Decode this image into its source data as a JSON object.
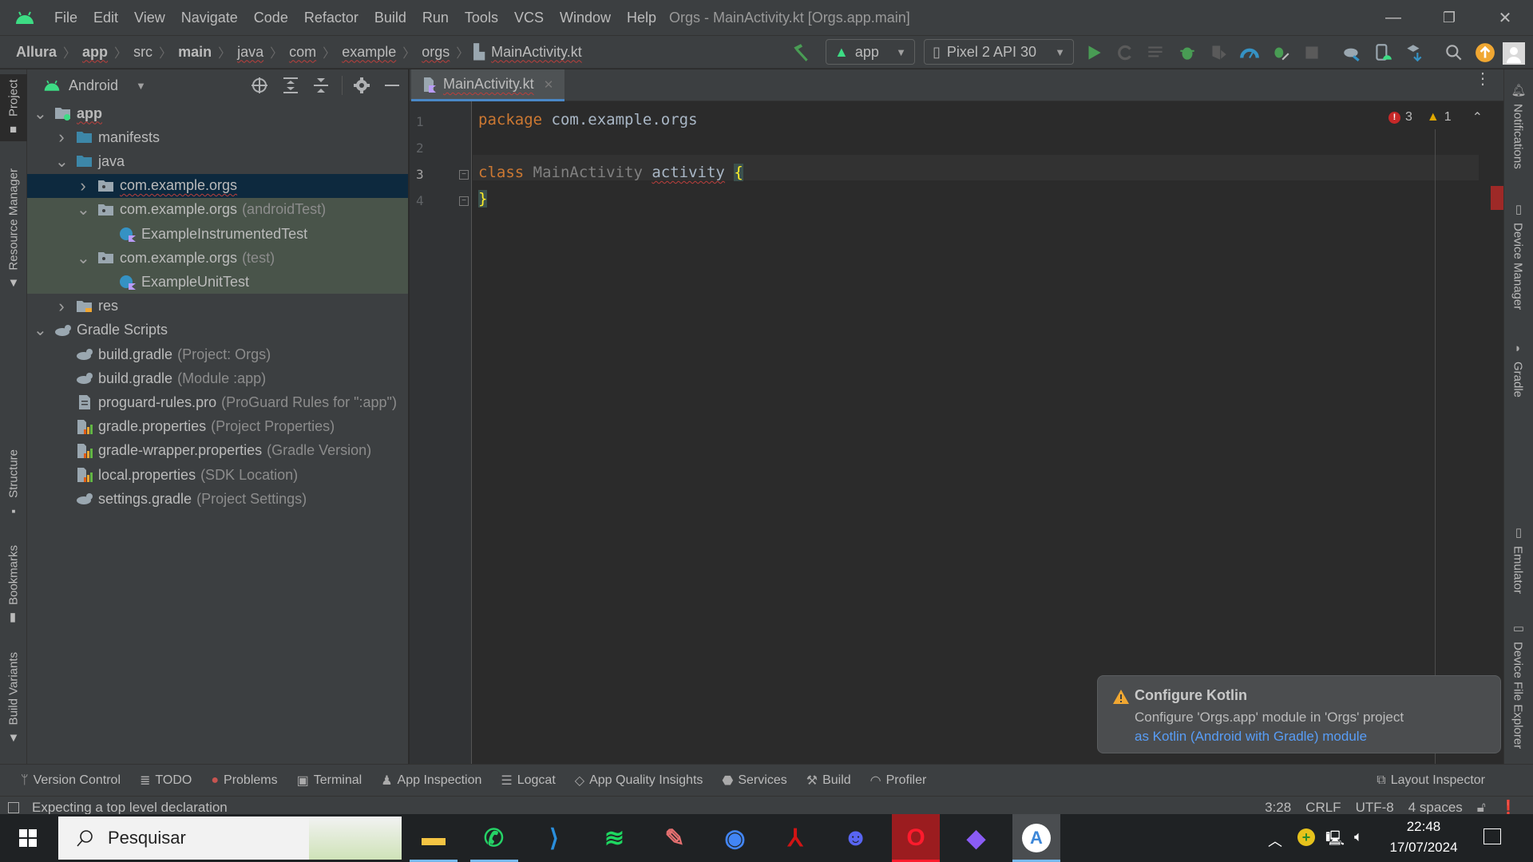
{
  "window": {
    "title": "Orgs - MainActivity.kt [Orgs.app.main]",
    "menu": [
      "File",
      "Edit",
      "View",
      "Navigate",
      "Code",
      "Refactor",
      "Build",
      "Run",
      "Tools",
      "VCS",
      "Window",
      "Help"
    ],
    "minimize": "—",
    "restore": "❐",
    "close": "✕"
  },
  "breadcrumb": [
    {
      "label": "Allura",
      "bold": true
    },
    {
      "label": "app",
      "bold": true
    },
    {
      "label": "src"
    },
    {
      "label": "main",
      "bold": true
    },
    {
      "label": "java"
    },
    {
      "label": "com"
    },
    {
      "label": "example"
    },
    {
      "label": "orgs"
    },
    {
      "label": "MainActivity.kt"
    }
  ],
  "toolbar": {
    "run_config": "app",
    "device": "Pixel 2 API 30",
    "icons": [
      "hammer-icon",
      "run-icon",
      "apply-changes-icon",
      "apply-code-changes-icon",
      "debug-icon",
      "coverage-icon",
      "profile-icon",
      "attach-debugger-icon",
      "stop-icon",
      "gradle-sync-icon",
      "device-manager-icon",
      "sdk-manager-icon",
      "search-icon",
      "update-icon",
      "avatar"
    ]
  },
  "left_strip": {
    "project": "Project",
    "resource_manager": "Resource Manager",
    "structure": "Structure",
    "bookmarks": "Bookmarks",
    "build_variants": "Build Variants"
  },
  "right_strip": {
    "notifications": "Notifications",
    "device_manager": "Device Manager",
    "gradle": "Gradle",
    "emulator": "Emulator",
    "device_file_explorer": "Device File Explorer"
  },
  "project": {
    "view_mode": "Android",
    "tree": [
      {
        "label": "app",
        "hint": "",
        "icon": "module",
        "chevron": "down",
        "indent": 0
      },
      {
        "label": "manifests",
        "hint": "",
        "icon": "folder",
        "chevron": "right",
        "indent": 1
      },
      {
        "label": "java",
        "hint": "",
        "icon": "folder",
        "chevron": "down",
        "indent": 1
      },
      {
        "label": "com.example.orgs",
        "hint": "",
        "icon": "package",
        "chevron": "right",
        "indent": 2,
        "state": "selected"
      },
      {
        "label": "com.example.orgs",
        "hint": "(androidTest)",
        "icon": "package",
        "chevron": "down",
        "indent": 2,
        "state": "test"
      },
      {
        "label": "ExampleInstrumentedTest",
        "hint": "",
        "icon": "kotlin-class",
        "chevron": "",
        "indent": 3,
        "state": "test"
      },
      {
        "label": "com.example.orgs",
        "hint": "(test)",
        "icon": "package",
        "chevron": "down",
        "indent": 2,
        "state": "test"
      },
      {
        "label": "ExampleUnitTest",
        "hint": "",
        "icon": "kotlin-class",
        "chevron": "",
        "indent": 3,
        "state": "test"
      },
      {
        "label": "res",
        "hint": "",
        "icon": "res-folder",
        "chevron": "right",
        "indent": 1
      },
      {
        "label": "Gradle Scripts",
        "hint": "",
        "icon": "gradle",
        "chevron": "down",
        "indent": 0
      },
      {
        "label": "build.gradle",
        "hint": "(Project: Orgs)",
        "icon": "gradle",
        "chevron": "",
        "indent": 1
      },
      {
        "label": "build.gradle",
        "hint": "(Module :app)",
        "icon": "gradle",
        "chevron": "",
        "indent": 1
      },
      {
        "label": "proguard-rules.pro",
        "hint": "(ProGuard Rules for \":app\")",
        "icon": "text-file",
        "chevron": "",
        "indent": 1
      },
      {
        "label": "gradle.properties",
        "hint": "(Project Properties)",
        "icon": "properties",
        "chevron": "",
        "indent": 1
      },
      {
        "label": "gradle-wrapper.properties",
        "hint": "(Gradle Version)",
        "icon": "properties",
        "chevron": "",
        "indent": 1
      },
      {
        "label": "local.properties",
        "hint": "(SDK Location)",
        "icon": "properties",
        "chevron": "",
        "indent": 1
      },
      {
        "label": "settings.gradle",
        "hint": "(Project Settings)",
        "icon": "gradle",
        "chevron": "",
        "indent": 1
      }
    ]
  },
  "editor": {
    "tab": "MainActivity.kt",
    "errors": "3",
    "warnings": "1",
    "lines": [
      {
        "n": "1",
        "tokens": [
          {
            "t": "package ",
            "c": "kw"
          },
          {
            "t": "com.example.orgs",
            "c": ""
          }
        ]
      },
      {
        "n": "2",
        "tokens": []
      },
      {
        "n": "3",
        "tokens": [
          {
            "t": "class ",
            "c": "kw"
          },
          {
            "t": "MainActivity ",
            "c": "cls"
          },
          {
            "t": "activity",
            "c": "err"
          },
          {
            "t": " ",
            "c": ""
          },
          {
            "t": "{",
            "c": "brace"
          }
        ]
      },
      {
        "n": "4",
        "tokens": [
          {
            "t": "}",
            "c": "brace"
          }
        ]
      }
    ]
  },
  "notification": {
    "title": "Configure Kotlin",
    "body": "Configure 'Orgs.app' module in 'Orgs' project",
    "link": "as Kotlin (Android with Gradle) module"
  },
  "bottom_tools": [
    {
      "label": "Version Control",
      "icon": "version-control-icon"
    },
    {
      "label": "TODO",
      "icon": "todo-icon"
    },
    {
      "label": "Problems",
      "icon": "problems-icon"
    },
    {
      "label": "Terminal",
      "icon": "terminal-icon"
    },
    {
      "label": "App Inspection",
      "icon": "app-inspection-icon"
    },
    {
      "label": "Logcat",
      "icon": "logcat-icon"
    },
    {
      "label": "App Quality Insights",
      "icon": "app-quality-icon"
    },
    {
      "label": "Services",
      "icon": "services-icon"
    },
    {
      "label": "Build",
      "icon": "build-icon"
    },
    {
      "label": "Profiler",
      "icon": "profiler-icon"
    }
  ],
  "layout_inspector": "Layout Inspector",
  "status": {
    "message": "Expecting a top level declaration",
    "position": "3:28",
    "line_sep": "CRLF",
    "encoding": "UTF-8",
    "indent": "4 spaces"
  },
  "taskbar": {
    "search_placeholder": "Pesquisar",
    "apps": [
      "file-explorer",
      "whatsapp",
      "vscode",
      "spotify",
      "notepad-plus-plus",
      "chrome",
      "acrobat",
      "discord",
      "opera",
      "obsidian",
      "android-studio"
    ],
    "time": "22:48",
    "date": "17/07/2024"
  }
}
